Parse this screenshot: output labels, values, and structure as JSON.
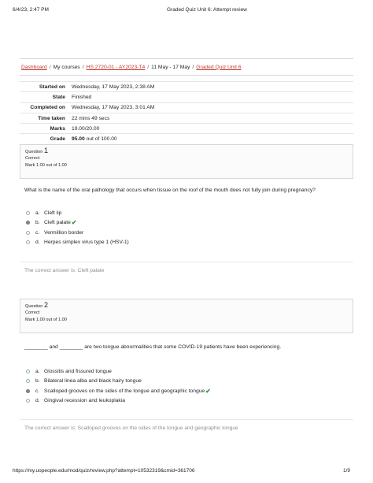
{
  "print_header": {
    "datetime": "6/4/23, 2:47 PM",
    "title": "Graded Quiz Unit 6: Attempt review"
  },
  "breadcrumb": {
    "items": [
      "Dashboard",
      "My courses",
      "HS 2720-01 - AY2023-T4",
      "11 May - 17 May",
      "Graded Quiz Unit 6"
    ],
    "separator": "/"
  },
  "summary": [
    {
      "label": "Started on",
      "value": "Wednesday, 17 May 2023, 2:38 AM"
    },
    {
      "label": "State",
      "value": "Finished"
    },
    {
      "label": "Completed on",
      "value": "Wednesday, 17 May 2023, 3:01 AM"
    },
    {
      "label": "Time taken",
      "value": "22 mins 49 secs"
    },
    {
      "label": "Marks",
      "value": "19.00/20.00"
    },
    {
      "label": "Grade",
      "value_bold": "95.00",
      "value_rest": " out of 100.00"
    }
  ],
  "questions": [
    {
      "label": "Question",
      "number": "1",
      "state": "Correct",
      "mark": "Mark 1.00 out of 1.00",
      "text": "What is the name of the oral pathology that occurs when tissue on the roof of the mouth does not fully join during pregnancy?",
      "options": [
        {
          "letter": "a.",
          "text": "Cleft lip",
          "selected": false
        },
        {
          "letter": "b.",
          "text": "Cleft palate",
          "selected": true
        },
        {
          "letter": "c.",
          "text": "Vermillion border",
          "selected": false
        },
        {
          "letter": "d.",
          "text": "Herpes simplex virus type 1 (HSV-1)",
          "selected": false
        }
      ],
      "feedback": "The correct answer is: Cleft palate"
    },
    {
      "label": "Question",
      "number": "2",
      "state": "Correct",
      "mark": "Mark 1.00 out of 1.00",
      "text": "________ and ________ are two tongue abnormalities that some COVID-19 patients have been experiencing.",
      "options": [
        {
          "letter": "a.",
          "text": "Glossitis and fissured tongue",
          "selected": false
        },
        {
          "letter": "b.",
          "text": "Bilateral linea alba and black hairy tongue",
          "selected": false
        },
        {
          "letter": "c.",
          "text": "Scalloped grooves on the sides of the tongue and geographic tongue",
          "selected": true
        },
        {
          "letter": "d.",
          "text": "Gingival recession and leukoplakia",
          "selected": false
        }
      ],
      "feedback": "The correct answer is: Scalloped grooves on the sides of the tongue and geographic tongue"
    }
  ],
  "print_footer": {
    "url": "https://my.uopeople.edu/mod/quiz/review.php?attempt=10532319&cmid=361706",
    "page": "1/9"
  },
  "icons": {
    "correct": "check-icon"
  },
  "colors": {
    "link": "#c0392b",
    "correct": "#2e9a3a"
  }
}
